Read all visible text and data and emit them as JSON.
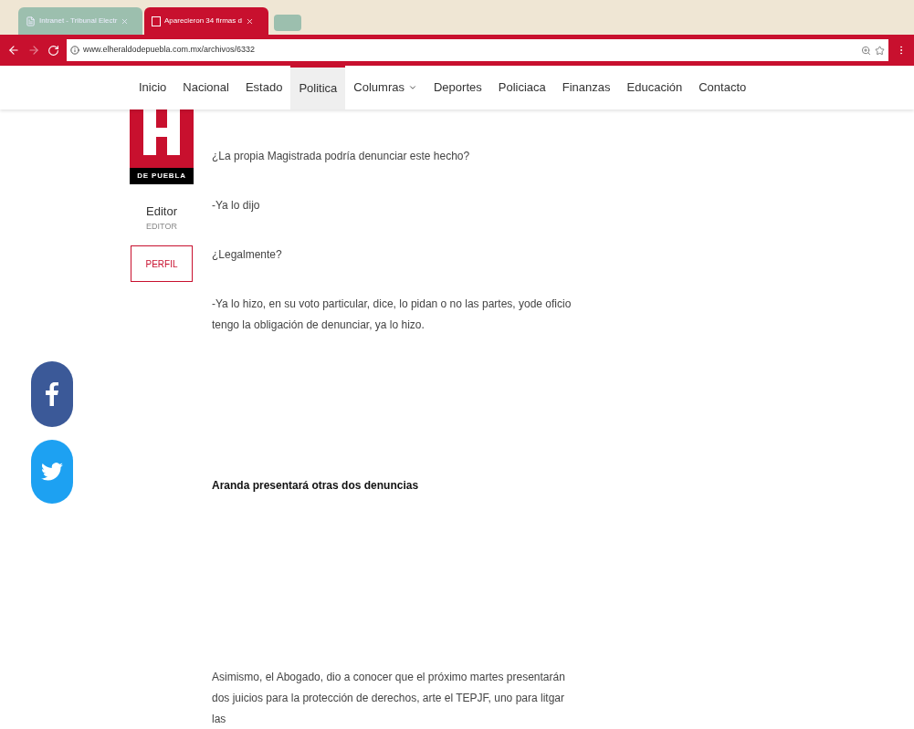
{
  "browser": {
    "tabs": [
      {
        "title": "Intranet - Tribunal Electr",
        "selected": false
      },
      {
        "title": "Aparecieron 34 firmas d",
        "selected": true
      }
    ],
    "url": "www.elheraldodepuebla.com.mx/archivos/6332"
  },
  "nav": [
    {
      "label": "Inicio",
      "selected": false
    },
    {
      "label": "Nacional",
      "selected": false
    },
    {
      "label": "Estado",
      "selected": false
    },
    {
      "label": "Politica",
      "selected": true
    },
    {
      "label": "Columras",
      "selected": false,
      "dropdown": true
    },
    {
      "label": "Deportes",
      "selected": false
    },
    {
      "label": "Policiaca",
      "selected": false
    },
    {
      "label": "Finanzas",
      "selected": false
    },
    {
      "label": "Educación",
      "selected": false
    },
    {
      "label": "Contacto",
      "selected": false
    }
  ],
  "author": {
    "logo_text": "DE PUEBLA",
    "name": "Editor",
    "role": "EDITOR",
    "button": "PERFIL"
  },
  "article": [
    {
      "kind": "paragraph",
      "text": "¿La propia Magistrada podría denunciar este hecho?"
    },
    {
      "kind": "paragraph",
      "text": "-Ya lo dijo"
    },
    {
      "kind": "paragraph",
      "text": "¿Legalmente?"
    },
    {
      "kind": "paragraph",
      "text": "-Ya lo hizo, en su voto particular, dice, lo pidan o no las partes, yode oficio tengo la obligación de denunciar, ya lo hizo."
    },
    {
      "kind": "heading",
      "text": "Aranda presentará otras dos denuncias"
    },
    {
      "kind": "paragraph",
      "text": "Asimismo, el Abogado, dio a conocer que el próximo martes presentarán dos juicios para la protección de derechos, arte el TEPJF, uno para litgar las"
    }
  ]
}
